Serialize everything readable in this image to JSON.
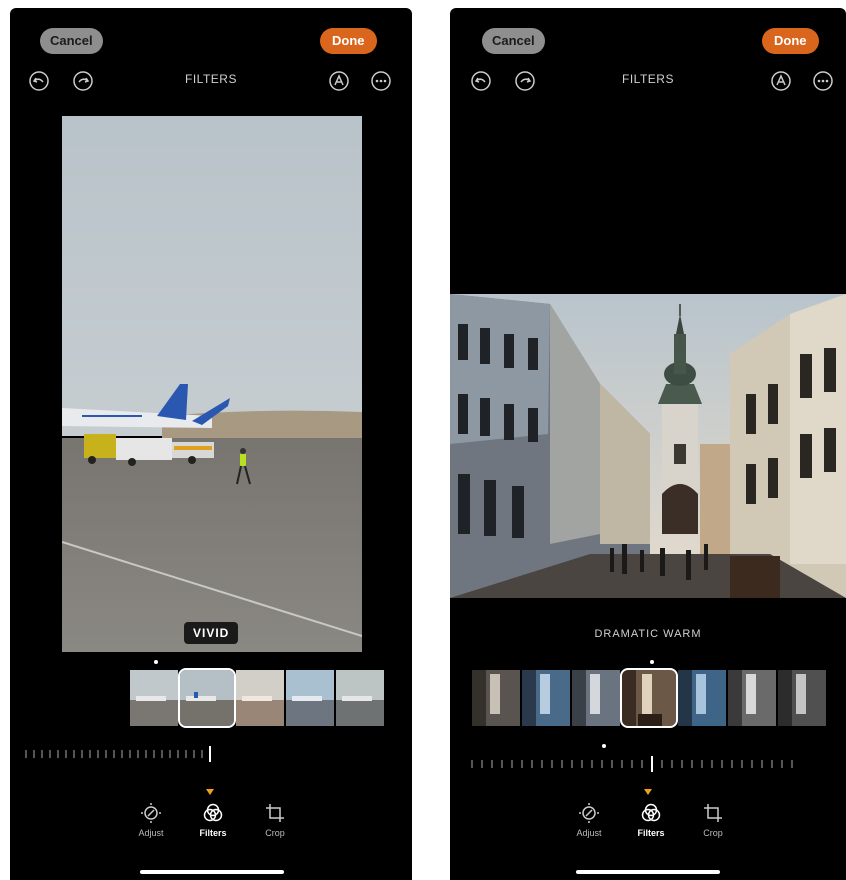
{
  "left": {
    "cancel_label": "Cancel",
    "done_label": "Done",
    "title": "FILTERS",
    "filter_name": "VIVID",
    "tabs": [
      {
        "label": "Adjust",
        "icon": "adjust-icon"
      },
      {
        "label": "Filters",
        "icon": "filters-icon"
      },
      {
        "label": "Crop",
        "icon": "crop-icon"
      }
    ]
  },
  "right": {
    "cancel_label": "Cancel",
    "done_label": "Done",
    "title": "FILTERS",
    "filter_name": "DRAMATIC WARM",
    "tabs": [
      {
        "label": "Adjust",
        "icon": "adjust-icon"
      },
      {
        "label": "Filters",
        "icon": "filters-icon"
      },
      {
        "label": "Crop",
        "icon": "crop-icon"
      }
    ]
  },
  "colors": {
    "done": "#d9661c",
    "cancel": "#8e8e8e",
    "marker": "#f0a020"
  }
}
